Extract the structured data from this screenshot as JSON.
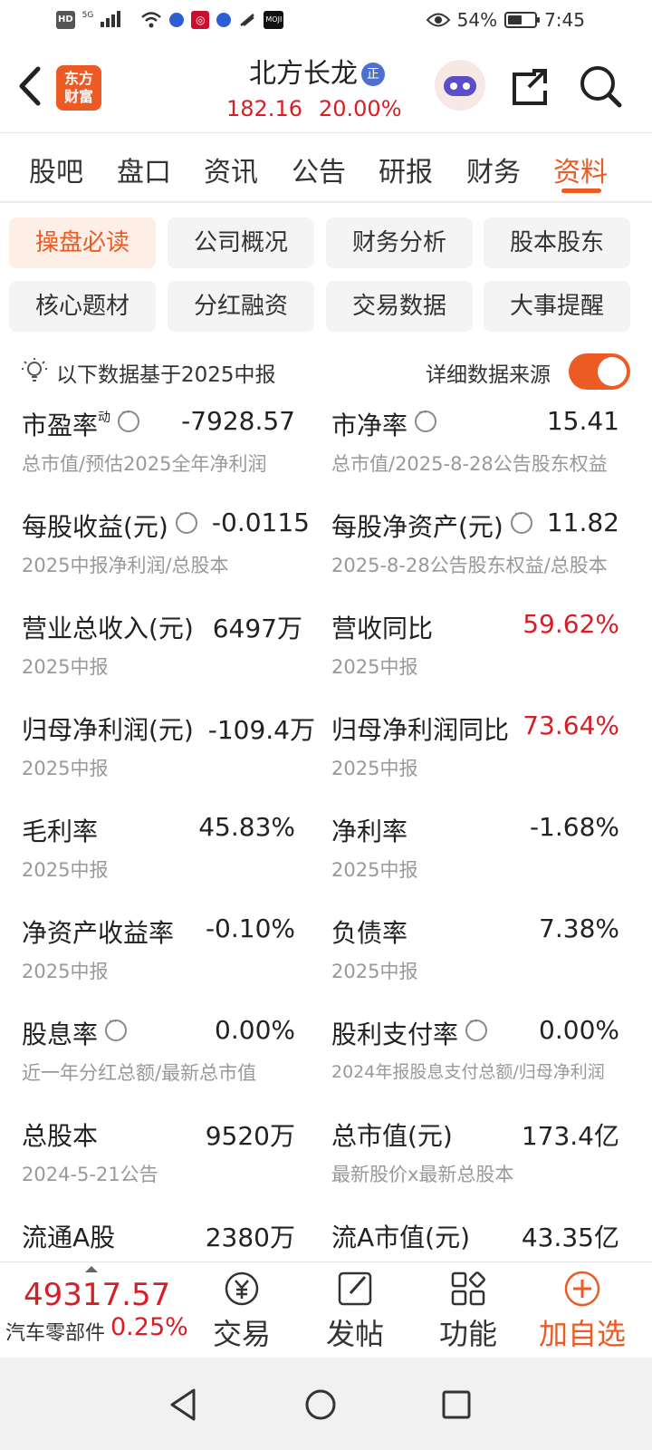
{
  "status_bar": {
    "hd": "HD",
    "network": "5G",
    "battery_percent": "54%",
    "battery_level": 0.54,
    "time": "7:45"
  },
  "header": {
    "logo_text_1": "东方",
    "logo_text_2": "财富",
    "stock_name": "北方长龙",
    "badge": "正",
    "price": "182.16",
    "change_pct": "20.00%"
  },
  "tabs": [
    {
      "label": "股吧"
    },
    {
      "label": "盘口"
    },
    {
      "label": "资讯"
    },
    {
      "label": "公告"
    },
    {
      "label": "研报"
    },
    {
      "label": "财务"
    },
    {
      "label": "资料",
      "active": true
    }
  ],
  "subtabs": [
    {
      "label": "操盘必读",
      "active": true
    },
    {
      "label": "公司概况"
    },
    {
      "label": "财务分析"
    },
    {
      "label": "股本股东"
    },
    {
      "label": "核心题材"
    },
    {
      "label": "分红融资"
    },
    {
      "label": "交易数据"
    },
    {
      "label": "大事提醒"
    }
  ],
  "source_row": {
    "basis_text": "以下数据基于2025中报",
    "source_link": "详细数据来源",
    "toggle_on": true
  },
  "metrics": {
    "pe": {
      "label": "市盈率",
      "sup": "动",
      "value": "-7928.57",
      "sub": "总市值/预估2025全年净利润"
    },
    "pb": {
      "label": "市净率",
      "value": "15.41",
      "sub": "总市值/2025-8-28公告股东权益"
    },
    "eps": {
      "label": "每股收益(元)",
      "value": "-0.0115",
      "sub": "2025中报净利润/总股本"
    },
    "bvps": {
      "label": "每股净资产(元)",
      "value": "11.82",
      "sub": "2025-8-28公告股东权益/总股本"
    },
    "revenue": {
      "label": "营业总收入(元)",
      "value": "6497万",
      "sub": "2025中报"
    },
    "revenue_yoy": {
      "label": "营收同比",
      "value": "59.62%",
      "sub": "2025中报"
    },
    "net_profit": {
      "label": "归母净利润(元)",
      "value": "-109.4万",
      "sub": "2025中报"
    },
    "net_profit_yoy": {
      "label": "归母净利润同比",
      "value": "73.64%",
      "sub": "2025中报"
    },
    "gross_margin": {
      "label": "毛利率",
      "value": "45.83%",
      "sub": "2025中报"
    },
    "net_margin": {
      "label": "净利率",
      "value": "-1.68%",
      "sub": "2025中报"
    },
    "roe": {
      "label": "净资产收益率",
      "value": "-0.10%",
      "sub": "2025中报"
    },
    "debt_ratio": {
      "label": "负债率",
      "value": "7.38%",
      "sub": "2025中报"
    },
    "dividend_yield": {
      "label": "股息率",
      "value": "0.00%",
      "sub": "近一年分红总额/最新总市值"
    },
    "payout_ratio": {
      "label": "股利支付率",
      "value": "0.00%",
      "sub": "2024年报股息支付总额/归母净利润"
    },
    "total_shares": {
      "label": "总股本",
      "value": "9520万",
      "sub": "2024-5-21公告"
    },
    "market_cap": {
      "label": "总市值(元)",
      "value": "173.4亿",
      "sub": "最新股价x最新总股本"
    },
    "float_shares": {
      "label": "流通A股",
      "value": "2380万"
    },
    "float_cap": {
      "label": "流A市值(元)",
      "value": "43.35亿"
    }
  },
  "bottom_bar": {
    "index_value": "49317.57",
    "index_name": "汽车零部件",
    "index_change": "0.25%",
    "trade": "交易",
    "post": "发帖",
    "functions": "功能",
    "add_watch": "加自选"
  },
  "colors": {
    "accent": "#ec5b24",
    "up_red": "#d81e25"
  }
}
